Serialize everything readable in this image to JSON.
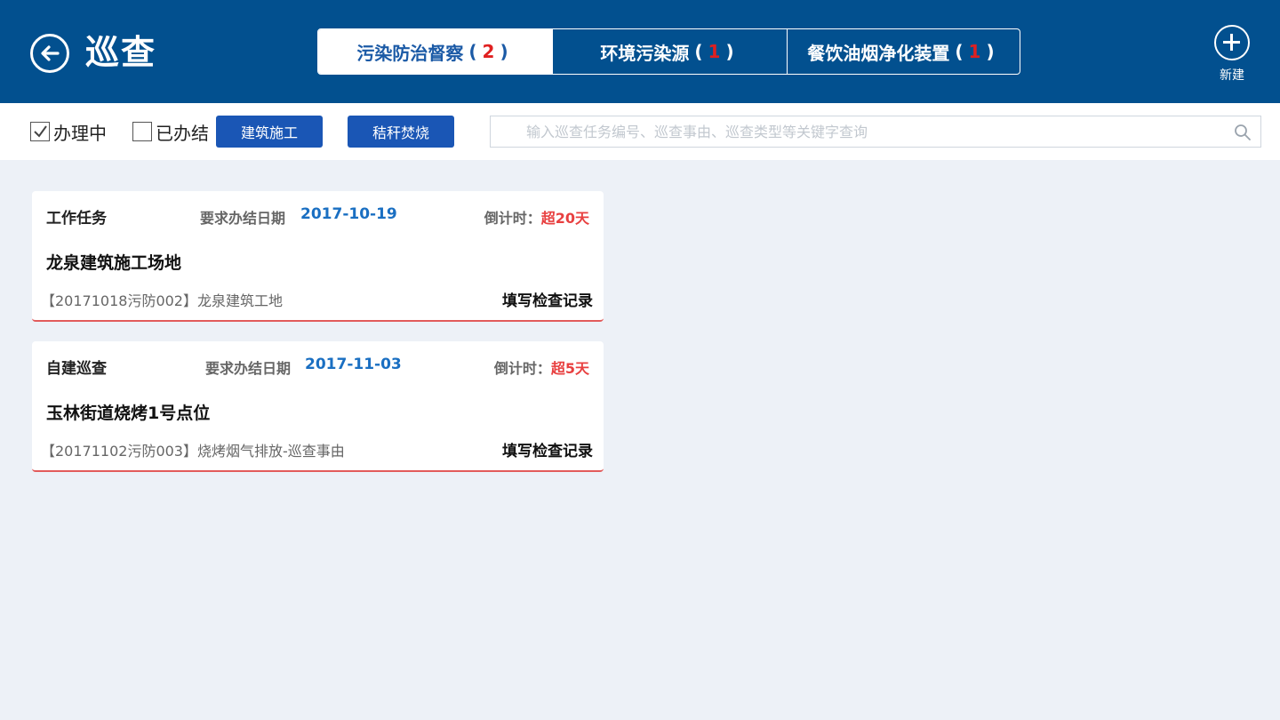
{
  "header": {
    "title": "巡查",
    "new_label": "新建",
    "tabs": [
      {
        "label": "污染防治督察",
        "count": "2",
        "open": "(",
        "close": ")"
      },
      {
        "label": "环境污染源",
        "count": "1",
        "open": "(",
        "close": ")"
      },
      {
        "label": "餐饮油烟净化装置",
        "count": "1",
        "open": "(",
        "close": ")"
      }
    ],
    "active_tab": 0
  },
  "filters": {
    "in_progress": {
      "label": "办理中",
      "checked": true
    },
    "completed": {
      "label": "已办结",
      "checked": false
    },
    "tags": [
      "建筑施工",
      "秸秆焚烧"
    ],
    "search": {
      "placeholder": "输入巡查任务编号、巡查事由、巡查类型等关键字查询",
      "value": ""
    }
  },
  "tasks": [
    {
      "type": "工作任务",
      "due_label": "要求办结日期",
      "due_date": "2017-10-19",
      "countdown_label": "倒计时：",
      "countdown_value": "超20天",
      "place": "龙泉建筑施工场地",
      "desc": "【20171018污防002】龙泉建筑工地",
      "action": "填写检查记录"
    },
    {
      "type": "自建巡查",
      "due_label": "要求办结日期",
      "due_date": "2017-11-03",
      "countdown_label": "倒计时：",
      "countdown_value": "超5天",
      "place": "玉林街道烧烤1号点位",
      "desc": "【20171102污防003】烧烤烟气排放-巡查事由",
      "action": "填写检查记录"
    }
  ],
  "colors": {
    "header_bg": "#02508f",
    "accent_blue": "#1a56b5",
    "date_blue": "#1a6fc2",
    "overdue_red": "#e84040",
    "page_bg": "#edf1f7"
  }
}
